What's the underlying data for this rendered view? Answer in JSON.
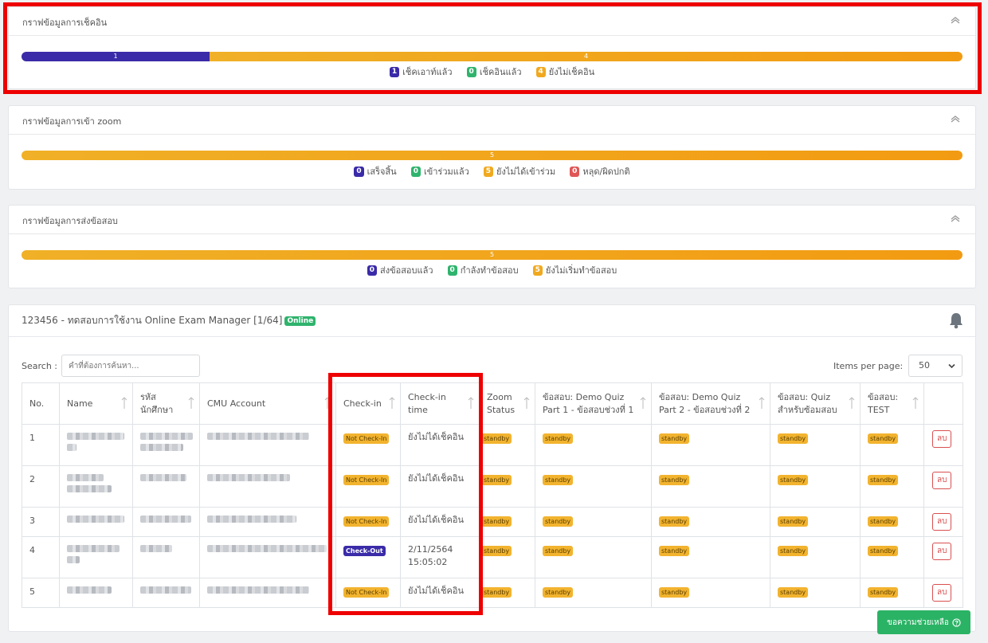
{
  "checkin_chart": {
    "title": "กราฟข้อมูลการเช็คอิน",
    "segments": [
      {
        "label": "1",
        "value": 1,
        "color": "#3a2ba8"
      },
      {
        "label": "4",
        "value": 4,
        "color": "#f0a91f"
      }
    ],
    "legend": [
      {
        "count": "1",
        "label": "เช็คเอาท์แล้ว",
        "color": "blue"
      },
      {
        "count": "0",
        "label": "เช็คอินแล้ว",
        "color": "green"
      },
      {
        "count": "4",
        "label": "ยังไม่เช็คอิน",
        "color": "orange"
      }
    ]
  },
  "zoom_chart": {
    "title": "กราฟข้อมูลการเข้า zoom",
    "segments": [
      {
        "label": "5",
        "value": 5,
        "color": "#f0a91f"
      }
    ],
    "legend": [
      {
        "count": "0",
        "label": "เสร็จสิ้น",
        "color": "blue"
      },
      {
        "count": "0",
        "label": "เข้าร่วมแล้ว",
        "color": "green"
      },
      {
        "count": "5",
        "label": "ยังไม่ได้เข้าร่วม",
        "color": "orange"
      },
      {
        "count": "0",
        "label": "หลุด/ผิดปกติ",
        "color": "red"
      }
    ]
  },
  "exam_chart": {
    "title": "กราฟข้อมูลการส่งข้อสอบ",
    "segments": [
      {
        "label": "5",
        "value": 5,
        "color": "#f0a91f"
      }
    ],
    "legend": [
      {
        "count": "0",
        "label": "ส่งข้อสอบแล้ว",
        "color": "blue"
      },
      {
        "count": "0",
        "label": "กำลังทำข้อสอบ",
        "color": "green"
      },
      {
        "count": "5",
        "label": "ยังไม่เริ่มทำข้อสอบ",
        "color": "orange"
      }
    ]
  },
  "course": {
    "title": "123456 - ทดสอบการใช้งาน Online Exam Manager [1/64]",
    "status_badge": "Online"
  },
  "controls": {
    "search_label": "Search :",
    "search_placeholder": "คำที่ต้องการค้นหา...",
    "items_per_page_label": "Items per page:",
    "items_per_page_value": "50"
  },
  "table": {
    "columns": [
      {
        "label": "No.",
        "sortable": false
      },
      {
        "label": "Name",
        "sortable": true
      },
      {
        "label": "รหัส นักศึกษา",
        "sortable": true
      },
      {
        "label": "CMU Account",
        "sortable": true
      },
      {
        "label": "Check-in",
        "sortable": true
      },
      {
        "label": "Check-in time",
        "sortable": true
      },
      {
        "label": "Zoom Status",
        "sortable": true
      },
      {
        "label": "ข้อสอบ: Demo Quiz Part 1 - ข้อสอบช่วงที่ 1",
        "sortable": true
      },
      {
        "label": "ข้อสอบ: Demo Quiz Part 2 - ข้อสอบช่วงที่ 2",
        "sortable": true
      },
      {
        "label": "ข้อสอบ: Quiz สำหรับซ้อมสอบ",
        "sortable": true
      },
      {
        "label": "ข้อสอบ: TEST",
        "sortable": true
      },
      {
        "label": "",
        "sortable": false
      }
    ],
    "rows": [
      {
        "no": "1",
        "checkin": "Not Check-In",
        "checkin_style": "orange",
        "checkin_time": "ยังไม่ได้เช็คอิน",
        "zoom": "standby",
        "quiz1": "standby",
        "quiz2": "standby",
        "quiz3": "standby",
        "quiz4": "standby",
        "action": "ลบ"
      },
      {
        "no": "2",
        "checkin": "Not Check-In",
        "checkin_style": "orange",
        "checkin_time": "ยังไม่ได้เช็คอิน",
        "zoom": "standby",
        "quiz1": "standby",
        "quiz2": "standby",
        "quiz3": "standby",
        "quiz4": "standby",
        "action": "ลบ"
      },
      {
        "no": "3",
        "checkin": "Not Check-In",
        "checkin_style": "orange",
        "checkin_time": "ยังไม่ได้เช็คอิน",
        "zoom": "standby",
        "quiz1": "standby",
        "quiz2": "standby",
        "quiz3": "standby",
        "quiz4": "standby",
        "action": "ลบ"
      },
      {
        "no": "4",
        "checkin": "Check-Out",
        "checkin_style": "blue",
        "checkin_time": "2/11/2564 15:05:02",
        "zoom": "standby",
        "quiz1": "standby",
        "quiz2": "standby",
        "quiz3": "standby",
        "quiz4": "standby",
        "action": "ลบ"
      },
      {
        "no": "5",
        "checkin": "Not Check-In",
        "checkin_style": "orange",
        "checkin_time": "ยังไม่ได้เช็คอิน",
        "zoom": "standby",
        "quiz1": "standby",
        "quiz2": "standby",
        "quiz3": "standby",
        "quiz4": "standby",
        "action": "ลบ"
      }
    ]
  },
  "help_button": {
    "label": "ขอความช่วยเหลือ"
  }
}
